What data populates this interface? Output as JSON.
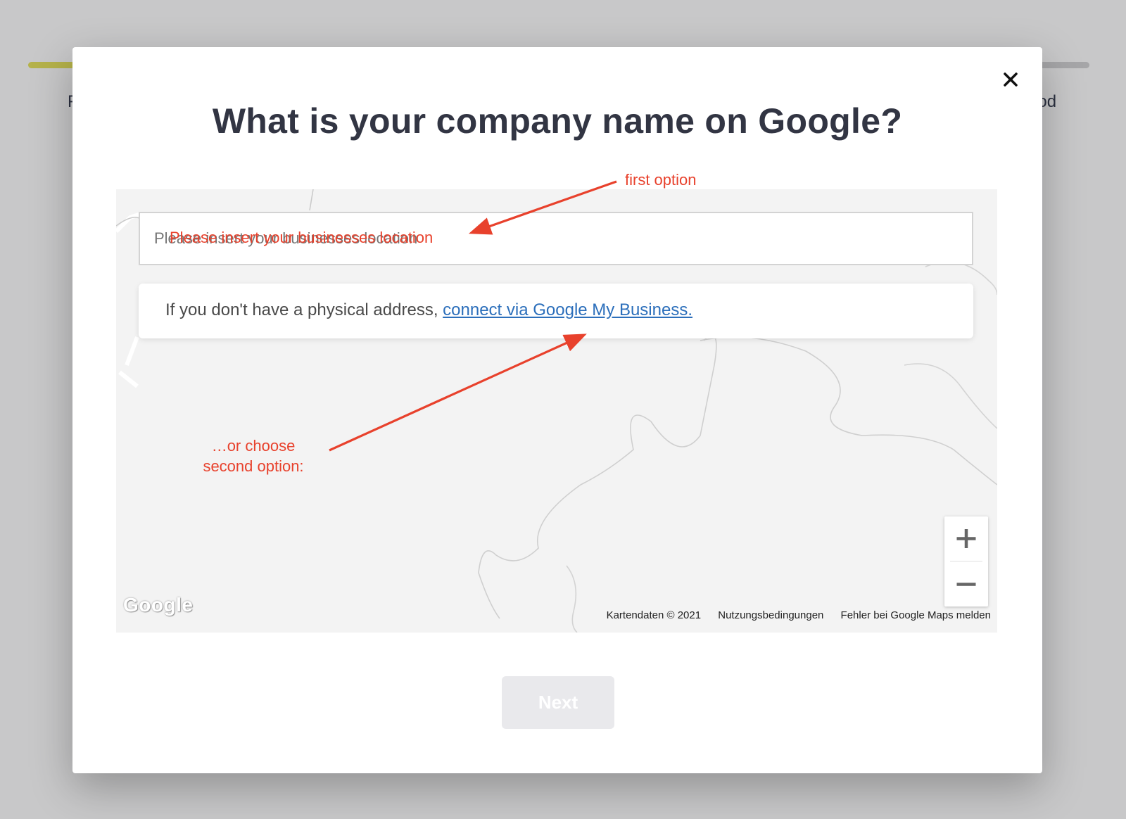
{
  "background": {
    "left_text": "F",
    "right_text": "nod",
    "progress_color": "#b5b24a"
  },
  "modal": {
    "title": "What is your company name on Google?",
    "close_icon": "close-icon",
    "location_input": {
      "value": "",
      "placeholder": "Please insert your businesses location"
    },
    "info": {
      "text": "If you don't have a physical address, ",
      "link": "connect via Google My Business."
    },
    "map": {
      "zoom_in_icon": "plus-icon",
      "zoom_out_icon": "minus-icon",
      "logo": "Google",
      "footer": {
        "data": "Kartendaten © 2021",
        "terms": "Nutzungsbedingungen",
        "report": "Fehler bei Google Maps melden"
      }
    },
    "next_button": "Next"
  },
  "annotations": {
    "first": "first option",
    "second_line1": "…or choose",
    "second_line2": "second option:",
    "color": "#e8412c"
  }
}
